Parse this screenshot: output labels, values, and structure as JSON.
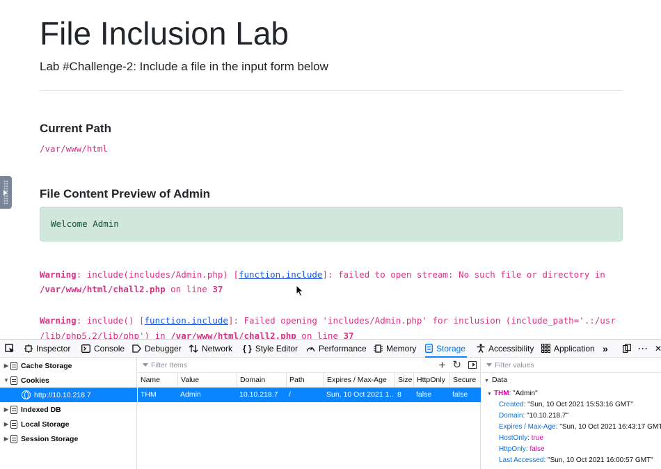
{
  "page": {
    "title": "File Inclusion Lab",
    "subtitle": "Lab #Challenge-2: Include a file in the input form below",
    "current_path_heading": "Current Path",
    "current_path": "/var/www/html",
    "preview_heading": "File Content Preview of",
    "preview_name": "Admin",
    "preview_content": "Welcome Admin",
    "warnings": [
      {
        "label": "Warning",
        "line1_a": ": include(includes/Admin.php) [",
        "link": "function.include",
        "line1_b": "]: failed to open stream: No such file or directory in",
        "file": "/var/www/html/chall2.php",
        "on_line": " on line ",
        "line_no": "37"
      },
      {
        "label": "Warning",
        "line1_a": ": include() [",
        "link": "function.include",
        "line1_b": "]: Failed opening 'includes/Admin.php' for inclusion (include_path='.:/usr",
        "line2_a": "/lib/php5.2/lib/php') in ",
        "file": "/var/www/html/chall2.php",
        "on_line": " on line ",
        "line_no": "37"
      }
    ]
  },
  "devtools": {
    "tabs": [
      {
        "label": "Inspector",
        "icon": "inspector-icon"
      },
      {
        "label": "Console",
        "icon": "console-icon"
      },
      {
        "label": "Debugger",
        "icon": "debugger-icon"
      },
      {
        "label": "Network",
        "icon": "network-icon"
      },
      {
        "label": "Style Editor",
        "icon": "style-editor-icon"
      },
      {
        "label": "Performance",
        "icon": "performance-icon"
      },
      {
        "label": "Memory",
        "icon": "memory-icon"
      },
      {
        "label": "Storage",
        "icon": "storage-icon"
      },
      {
        "label": "Accessibility",
        "icon": "accessibility-icon"
      },
      {
        "label": "Application",
        "icon": "application-icon"
      }
    ],
    "active_tab": "Storage",
    "tree": {
      "cache_storage": "Cache Storage",
      "cookies": "Cookies",
      "cookie_host": "http://10.10.218.7",
      "indexed_db": "Indexed DB",
      "local_storage": "Local Storage",
      "session_storage": "Session Storage"
    },
    "table": {
      "filter_placeholder": "Filter Items",
      "columns": [
        "Name",
        "Value",
        "Domain",
        "Path",
        "Expires / Max-Age",
        "Size",
        "HttpOnly",
        "Secure"
      ],
      "row": [
        "THM",
        "Admin",
        "10.10.218.7",
        "/",
        "Sun, 10 Oct 2021 1…",
        "8",
        "false",
        "false"
      ]
    },
    "sidebar": {
      "filter_placeholder": "Filter values",
      "section": "Data",
      "cookie_name": "THM",
      "cookie_value": "\"Admin\"",
      "fields": [
        {
          "key": "Created",
          "value": "\"Sun, 10 Oct 2021 15:53:16 GMT\"",
          "kind": "str"
        },
        {
          "key": "Domain",
          "value": "\"10.10.218.7\"",
          "kind": "str"
        },
        {
          "key": "Expires / Max-Age",
          "value": "\"Sun, 10 Oct 2021 16:43:17 GMT\"",
          "kind": "str"
        },
        {
          "key": "HostOnly",
          "value": "true",
          "kind": "bool"
        },
        {
          "key": "HttpOnly",
          "value": "false",
          "kind": "bool"
        },
        {
          "key": "Last Accessed",
          "value": "\"Sun, 10 Oct 2021 16:00:57 GMT\"",
          "kind": "str"
        }
      ]
    }
  },
  "colors": {
    "accent": "#0a84ff",
    "code_pink": "#d63384",
    "alert_bg": "#d1e7dd"
  }
}
